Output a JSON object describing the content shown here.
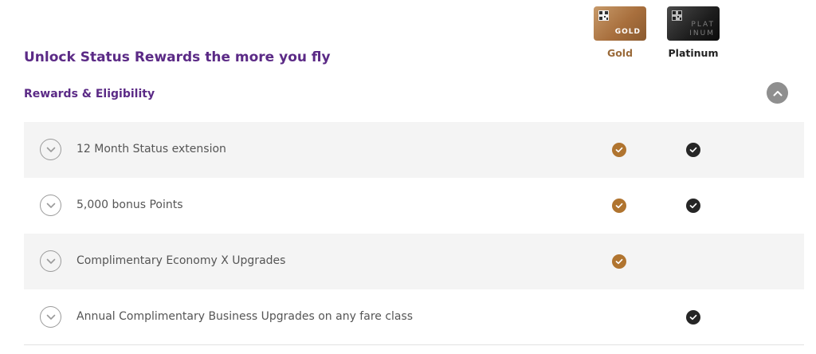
{
  "header": {
    "title": "Unlock Status Rewards the more you fly",
    "section_title": "Rewards & Eligibility"
  },
  "tiers": [
    {
      "name": "Gold",
      "card_text": "GOLD",
      "color": "#b0742f"
    },
    {
      "name": "Platinum",
      "card_text": "PLAT INUM",
      "color": "#262626"
    }
  ],
  "rows": [
    {
      "label": "12 Month Status extension",
      "gold": true,
      "platinum": true
    },
    {
      "label": "5,000 bonus Points",
      "gold": true,
      "platinum": true
    },
    {
      "label": "Complimentary Economy X Upgrades",
      "gold": true,
      "platinum": false
    },
    {
      "label": "Annual Complimentary Business Upgrades on any fare class",
      "gold": false,
      "platinum": true
    }
  ],
  "icons": {
    "collapse": "chevron-up-icon",
    "row_toggle": "chevron-down-icon",
    "check": "check-icon",
    "card_qr": "qr-code-icon"
  },
  "colors": {
    "title": "#5b2a86",
    "gold": "#b0742f",
    "platinum": "#262626",
    "row_shade": "#f4f4f4"
  }
}
